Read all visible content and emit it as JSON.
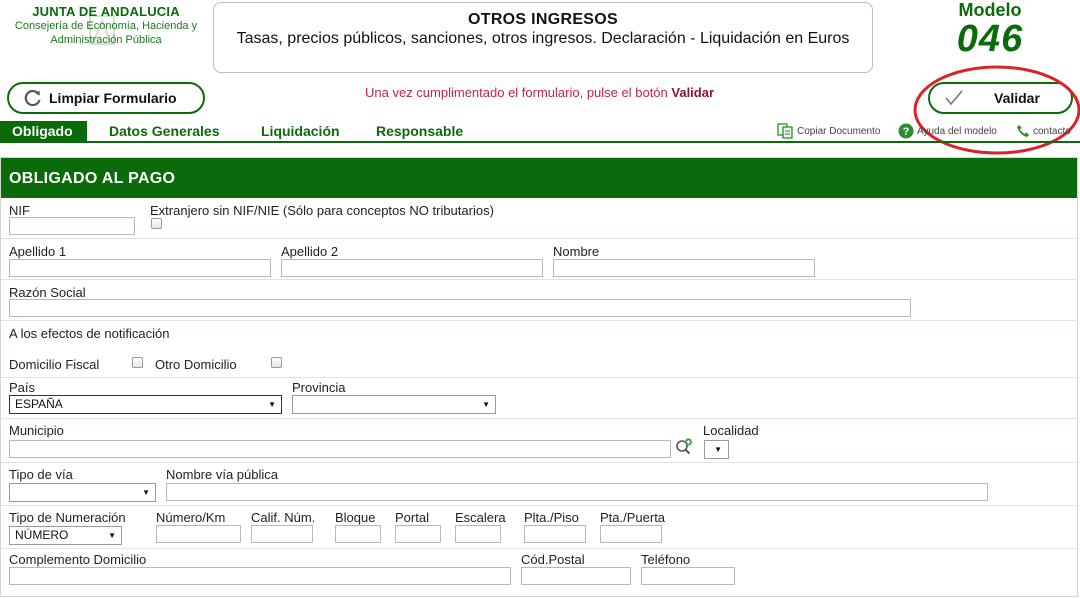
{
  "header": {
    "org_name": "JUNTA DE ANDALUCIA",
    "dept_line1": "Consejería de Economía, Hacienda y",
    "dept_line2": "Administración Pública",
    "form_title": "OTROS INGRESOS",
    "form_subtitle": "Tasas, precios públicos, sanciones, otros ingresos. Declaración - Liquidación en Euros",
    "modelo_label": "Modelo",
    "modelo_number": "046"
  },
  "toolbar": {
    "clear_label": "Limpiar Formulario",
    "notice_text": "Una vez cumplimentado el formulario, pulse el botón ",
    "notice_bold": "Validar",
    "validate_label": "Validar"
  },
  "tabs": [
    {
      "label": "Obligado",
      "active": true
    },
    {
      "label": "Datos Generales",
      "active": false
    },
    {
      "label": "Liquidación",
      "active": false
    },
    {
      "label": "Responsable",
      "active": false
    }
  ],
  "tools": {
    "copy_doc": "Copiar Documento",
    "help": "Ayuda del modelo",
    "contact": "contacto"
  },
  "section": {
    "title": "OBLIGADO AL PAGO",
    "nif_label": "NIF",
    "nif_value": "",
    "foreign_label": "Extranjero sin NIF/NIE (Sólo para conceptos NO tributarios)",
    "apellido1_label": "Apellido 1",
    "apellido2_label": "Apellido 2",
    "nombre_label": "Nombre",
    "razon_label": "Razón Social",
    "notif_label": "A los efectos de notificación",
    "domfiscal_label": "Domicilio Fiscal",
    "otrodom_label": "Otro Domicilio",
    "pais_label": "País",
    "pais_value": "ESPAÑA",
    "provincia_label": "Provincia",
    "provincia_value": "",
    "municipio_label": "Municipio",
    "localidad_label": "Localidad",
    "tipovia_label": "Tipo de vía",
    "tipovia_value": "",
    "nombrevia_label": "Nombre vía pública",
    "tiponum_label": "Tipo de Numeración",
    "tiponum_value": "NÚMERO",
    "numkm_label": "Número/Km",
    "calif_label": "Calif. Núm.",
    "bloque_label": "Bloque",
    "portal_label": "Portal",
    "escalera_label": "Escalera",
    "planta_label": "Plta./Piso",
    "puerta_label": "Pta./Puerta",
    "complemento_label": "Complemento Domicilio",
    "cp_label": "Cód.Postal",
    "telefono_label": "Teléfono"
  },
  "colors": {
    "brand_green": "#0b6b0b",
    "notice_red": "#c0254b",
    "annotation_red": "#d8232a"
  }
}
